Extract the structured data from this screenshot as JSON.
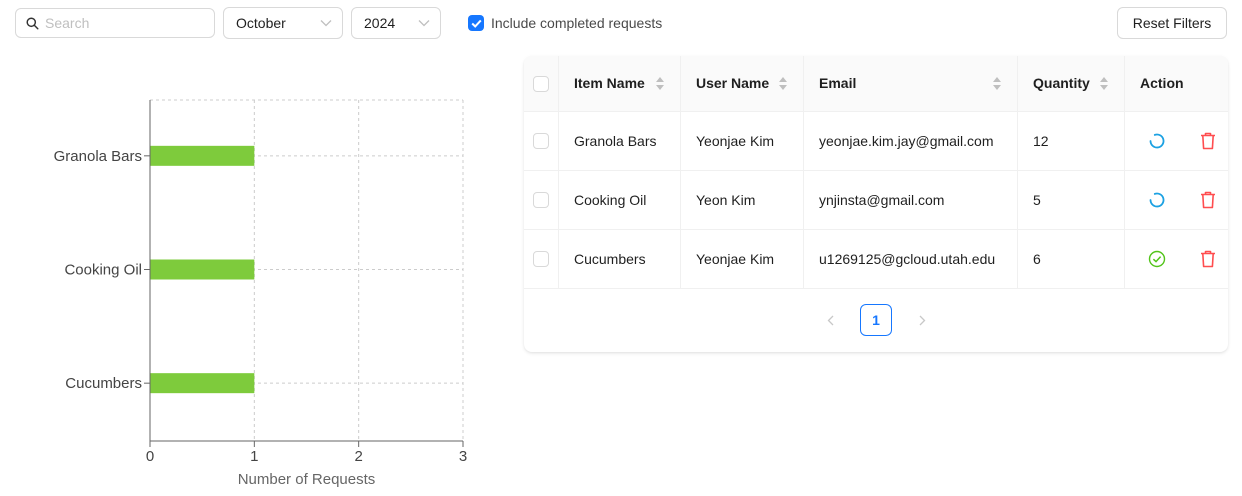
{
  "filters": {
    "search_placeholder": "Search",
    "month": "October",
    "year": "2024",
    "include_completed_label": "Include completed requests",
    "include_completed_checked": true,
    "reset_label": "Reset Filters"
  },
  "colors": {
    "accent": "#1677ff",
    "bar": "#7ecb3c",
    "pending_icon": "#1ba1e2",
    "completed_icon": "#52c41a",
    "delete_icon": "#ff4d4f"
  },
  "chart_data": {
    "type": "bar",
    "orientation": "horizontal",
    "categories": [
      "Granola Bars",
      "Cooking Oil",
      "Cucumbers"
    ],
    "values": [
      1,
      1,
      1
    ],
    "xlabel": "Number of Requests",
    "ylabel": "",
    "xlim": [
      0,
      3
    ],
    "xticks": [
      "0",
      "1",
      "2",
      "3"
    ],
    "grid": true
  },
  "table": {
    "columns": [
      "Item Name",
      "User Name",
      "Email",
      "Quantity",
      "Action"
    ],
    "rows": [
      {
        "item": "Granola Bars",
        "user": "Yeonjae Kim",
        "email": "yeonjae.kim.jay@gmail.com",
        "quantity": "12",
        "status_icon": "loading-icon"
      },
      {
        "item": "Cooking Oil",
        "user": "Yeon Kim",
        "email": "ynjinsta@gmail.com",
        "quantity": "5",
        "status_icon": "loading-icon"
      },
      {
        "item": "Cucumbers",
        "user": "Yeonjae Kim",
        "email": "u1269125@gcloud.utah.edu",
        "quantity": "6",
        "status_icon": "check-circle-icon"
      }
    ]
  },
  "pagination": {
    "current_page": "1"
  }
}
